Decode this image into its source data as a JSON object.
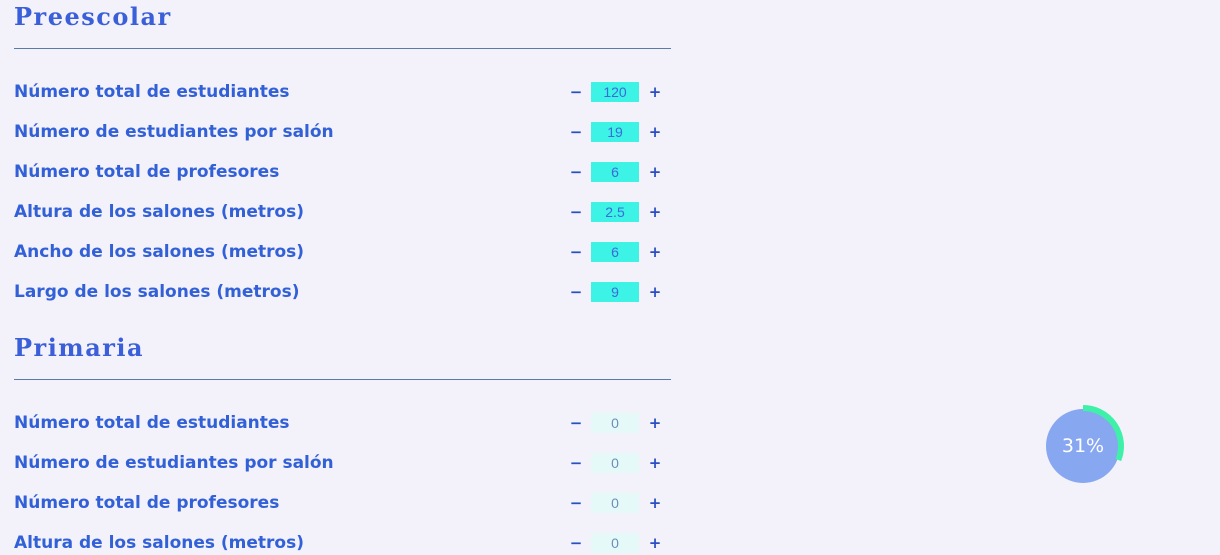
{
  "sections": [
    {
      "title": "Preescolar",
      "rows": [
        {
          "label": "Número total de estudiantes",
          "value": "120",
          "minus": "−",
          "plus": "+"
        },
        {
          "label": "Número de estudiantes por salón",
          "value": "19",
          "minus": "−",
          "plus": "+"
        },
        {
          "label": "Número total de profesores",
          "value": "6",
          "minus": "−",
          "plus": "+"
        },
        {
          "label": "Altura de los salones (metros)",
          "value": "2.5",
          "minus": "−",
          "plus": "+"
        },
        {
          "label": "Ancho de los salones (metros)",
          "value": "6",
          "minus": "−",
          "plus": "+"
        },
        {
          "label": "Largo de los salones (metros)",
          "value": "9",
          "minus": "−",
          "plus": "+"
        }
      ]
    },
    {
      "title": "Primaria",
      "rows": [
        {
          "label": "Número total de estudiantes",
          "value": "0",
          "minus": "−",
          "plus": "+"
        },
        {
          "label": "Número de estudiantes por salón",
          "value": "0",
          "minus": "−",
          "plus": "+"
        },
        {
          "label": "Número total de profesores",
          "value": "0",
          "minus": "−",
          "plus": "+"
        },
        {
          "label": "Altura de los salones (metros)",
          "value": "0",
          "minus": "−",
          "plus": "+"
        }
      ]
    }
  ],
  "progress": {
    "label": "31%",
    "fraction": 0.31
  },
  "colors": {
    "background": "#f3f2fb",
    "heading": "#3a5fd9",
    "label": "#3260d6",
    "value_filled_bg": "#3cf3e6",
    "value_empty_bg": "#e6f9f9",
    "progress_circle": "#87a7f0",
    "progress_ring": "#3ff0a8"
  }
}
